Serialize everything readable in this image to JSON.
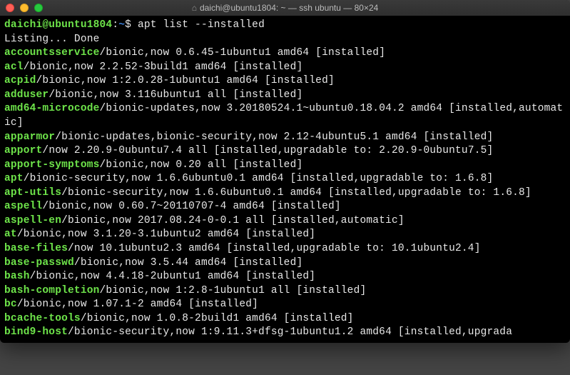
{
  "window": {
    "title": "daichi@ubuntu1804: ~ — ssh ubuntu — 80×24",
    "home_icon": "⌂"
  },
  "prompt": {
    "user_host": "daichi@ubuntu1804",
    "colon": ":",
    "path": "~",
    "dollar": "$",
    "command": " apt list --installed"
  },
  "listing_line": "Listing... Done",
  "packages": [
    {
      "name": "accountsservice",
      "rest": "/bionic,now 0.6.45-1ubuntu1 amd64 [installed]"
    },
    {
      "name": "acl",
      "rest": "/bionic,now 2.2.52-3build1 amd64 [installed]"
    },
    {
      "name": "acpid",
      "rest": "/bionic,now 1:2.0.28-1ubuntu1 amd64 [installed]"
    },
    {
      "name": "adduser",
      "rest": "/bionic,now 3.116ubuntu1 all [installed]"
    },
    {
      "name": "amd64-microcode",
      "rest": "/bionic-updates,now 3.20180524.1~ubuntu0.18.04.2 amd64 [installed,automatic]"
    },
    {
      "name": "apparmor",
      "rest": "/bionic-updates,bionic-security,now 2.12-4ubuntu5.1 amd64 [installed]"
    },
    {
      "name": "apport",
      "rest": "/now 2.20.9-0ubuntu7.4 all [installed,upgradable to: 2.20.9-0ubuntu7.5]"
    },
    {
      "name": "apport-symptoms",
      "rest": "/bionic,now 0.20 all [installed]"
    },
    {
      "name": "apt",
      "rest": "/bionic-security,now 1.6.6ubuntu0.1 amd64 [installed,upgradable to: 1.6.8]"
    },
    {
      "name": "apt-utils",
      "rest": "/bionic-security,now 1.6.6ubuntu0.1 amd64 [installed,upgradable to: 1.6.8]"
    },
    {
      "name": "aspell",
      "rest": "/bionic,now 0.60.7~20110707-4 amd64 [installed]"
    },
    {
      "name": "aspell-en",
      "rest": "/bionic,now 2017.08.24-0-0.1 all [installed,automatic]"
    },
    {
      "name": "at",
      "rest": "/bionic,now 3.1.20-3.1ubuntu2 amd64 [installed]"
    },
    {
      "name": "base-files",
      "rest": "/now 10.1ubuntu2.3 amd64 [installed,upgradable to: 10.1ubuntu2.4]"
    },
    {
      "name": "base-passwd",
      "rest": "/bionic,now 3.5.44 amd64 [installed]"
    },
    {
      "name": "bash",
      "rest": "/bionic,now 4.4.18-2ubuntu1 amd64 [installed]"
    },
    {
      "name": "bash-completion",
      "rest": "/bionic,now 1:2.8-1ubuntu1 all [installed]"
    },
    {
      "name": "bc",
      "rest": "/bionic,now 1.07.1-2 amd64 [installed]"
    },
    {
      "name": "bcache-tools",
      "rest": "/bionic,now 1.0.8-2build1 amd64 [installed]"
    },
    {
      "name": "bind9-host",
      "rest": "/bionic-security,now 1:9.11.3+dfsg-1ubuntu1.2 amd64 [installed,upgrada"
    }
  ]
}
